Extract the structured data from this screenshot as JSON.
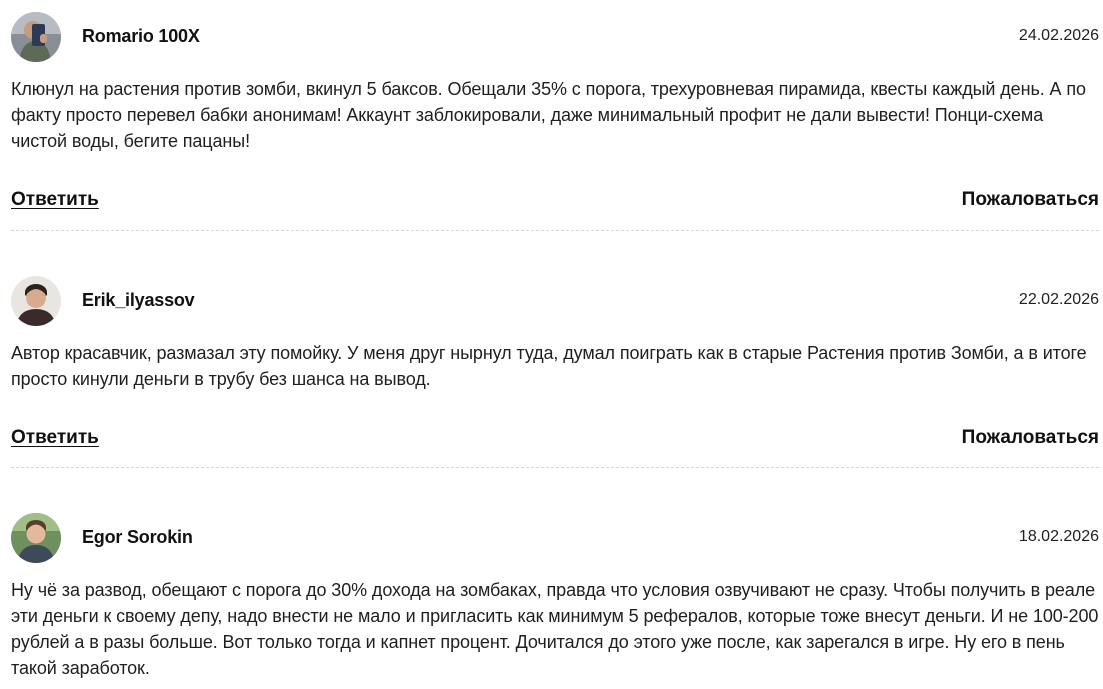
{
  "comments": [
    {
      "author": "Romario 100X",
      "date": "24.02.2026",
      "text": "Клюнул на растения против зомби, вкинул 5 баксов. Обещали 35% с порога, трехуровневая пирамида, квесты каждый день. А по факту просто перевел бабки анонимам! Аккаунт заблокировали, даже минимальный профит не дали вывести! Понци-схема чистой воды, бегите пацаны!",
      "reply_label": "Ответить",
      "report_label": "Пожаловаться"
    },
    {
      "author": "Erik_ilyassov",
      "date": "22.02.2026",
      "text": "Автор красавчик, размазал эту помойку. У меня друг нырнул туда, думал поиграть как в старые Растения против Зомби, а в итоге просто кинули деньги в трубу без шанса на вывод.",
      "reply_label": "Ответить",
      "report_label": "Пожаловаться"
    },
    {
      "author": "Egor Sorokin",
      "date": "18.02.2026",
      "text": "Ну чё за развод, обещают с порога до 30% дохода на зомбаках, правда что условия озвучивают не сразу. Чтобы получить в реале эти деньги к своему депу, надо внести не мало и пригласить как минимум 5 рефералов, которые тоже внесут деньги. И не 100-200 рублей а в разы больше. Вот только тогда и капнет процент. Дочитался до этого уже после, как зарегался в игре. Ну его в пень такой заработок."
    }
  ]
}
